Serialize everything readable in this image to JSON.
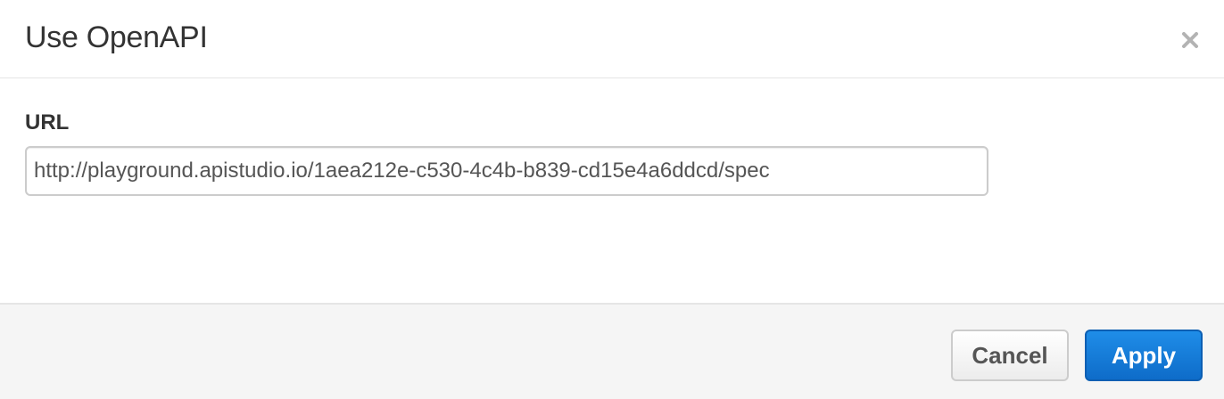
{
  "dialog": {
    "title": "Use OpenAPI",
    "close_icon": "close-icon"
  },
  "form": {
    "url_label": "URL",
    "url_value": "http://playground.apistudio.io/1aea212e-c530-4c4b-b839-cd15e4a6ddcd/spec"
  },
  "footer": {
    "cancel_label": "Cancel",
    "apply_label": "Apply"
  },
  "colors": {
    "apply_button": "#1a7fdc",
    "footer_background": "#f5f5f5",
    "close_icon": "#b3b3b3"
  }
}
